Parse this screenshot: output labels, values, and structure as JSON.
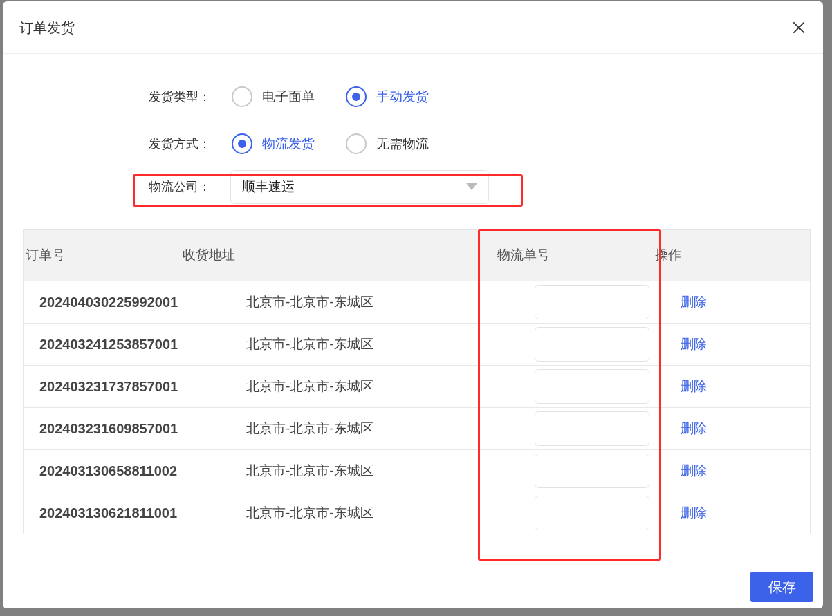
{
  "dialog": {
    "title": "订单发货"
  },
  "delivery_type": {
    "label": "发货类型：",
    "options": [
      {
        "label": "电子面单",
        "selected": false
      },
      {
        "label": "手动发货",
        "selected": true
      }
    ]
  },
  "delivery_method": {
    "label": "发货方式：",
    "options": [
      {
        "label": "物流发货",
        "selected": true
      },
      {
        "label": "无需物流",
        "selected": false
      }
    ]
  },
  "logistics_company": {
    "label": "物流公司：",
    "value": "顺丰速运"
  },
  "table": {
    "columns": [
      "订单号",
      "收货地址",
      "物流单号",
      "操作"
    ],
    "rows": [
      {
        "order_no": "202404030225992001",
        "address": "北京市-北京市-东城区",
        "action": "删除"
      },
      {
        "order_no": "202403241253857001",
        "address": "北京市-北京市-东城区",
        "action": "删除"
      },
      {
        "order_no": "202403231737857001",
        "address": "北京市-北京市-东城区",
        "action": "删除"
      },
      {
        "order_no": "202403231609857001",
        "address": "北京市-北京市-东城区",
        "action": "删除"
      },
      {
        "order_no": "202403130658811002",
        "address": "北京市-北京市-东城区",
        "action": "删除"
      },
      {
        "order_no": "202403130621811001",
        "address": "北京市-北京市-东城区",
        "action": "删除"
      }
    ]
  },
  "save_button": "保存"
}
